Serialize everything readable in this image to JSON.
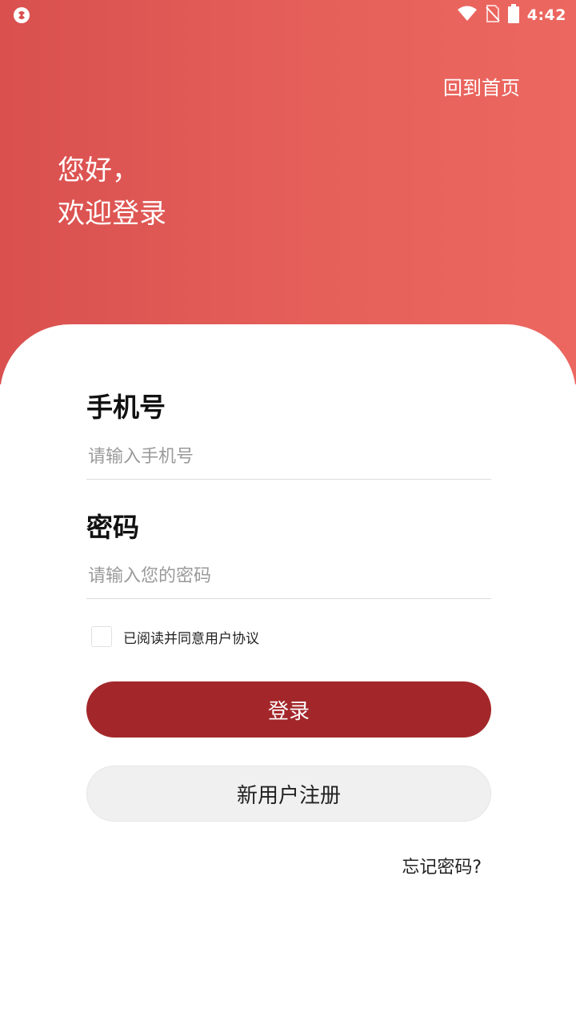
{
  "status_bar": {
    "time": "4:42",
    "icons": [
      "app-notification-icon",
      "wifi-icon",
      "no-sim-icon",
      "battery-icon"
    ]
  },
  "header": {
    "home_link": "回到首页",
    "greeting_line1": "您好，",
    "greeting_line2": "欢迎登录"
  },
  "form": {
    "phone_label": "手机号",
    "phone_placeholder": "请输入手机号",
    "password_label": "密码",
    "password_placeholder": "请输入您的密码",
    "agreement_text": "已阅读并同意用户协议",
    "agreement_checked": false
  },
  "buttons": {
    "login": "登录",
    "register": "新用户注册",
    "forgot": "忘记密码?"
  },
  "colors": {
    "header_gradient_start": "#d9504f",
    "header_gradient_end": "#ec6760",
    "login_button": "#a3272a",
    "register_button": "#f0f0f0"
  }
}
